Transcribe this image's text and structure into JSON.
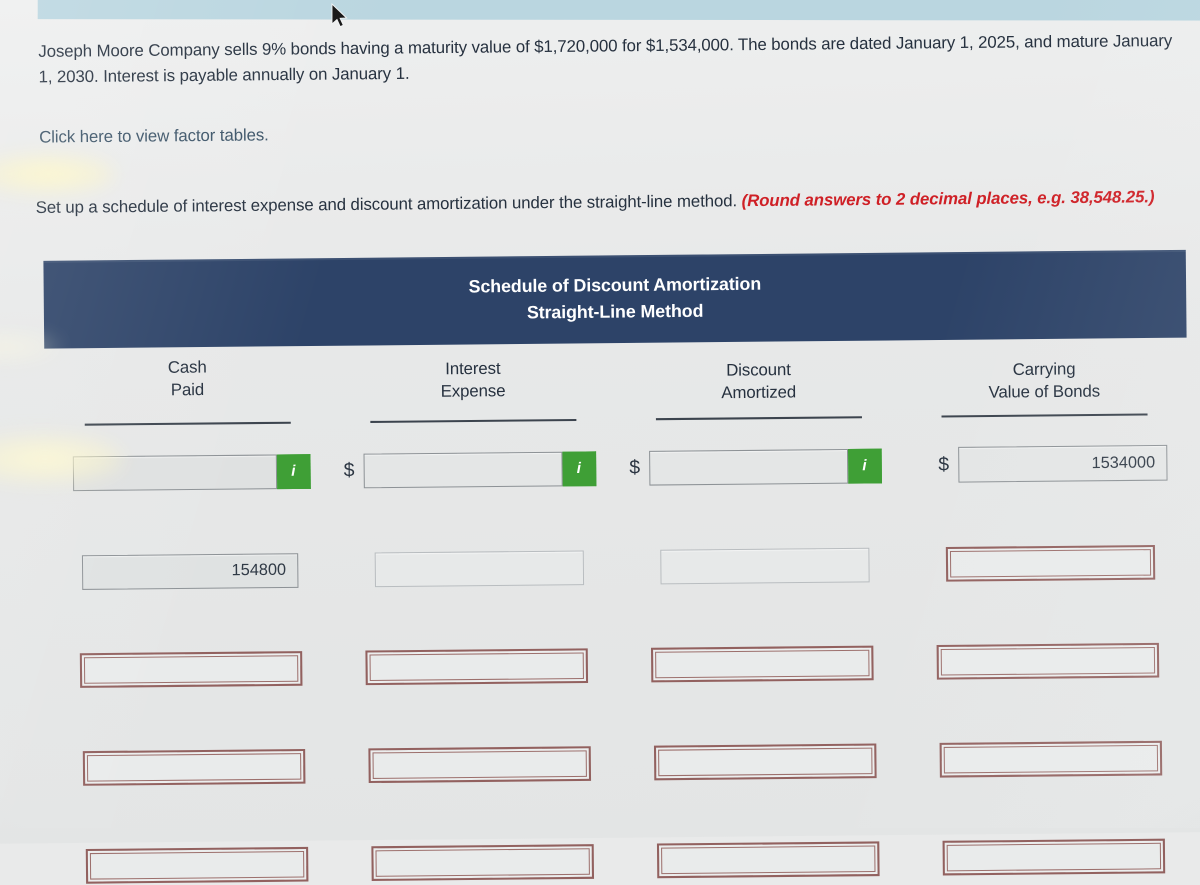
{
  "problem": {
    "text": "Joseph Moore Company sells 9% bonds having a maturity value of $1,720,000 for $1,534,000. The bonds are dated January 1, 2025, and mature January 1, 2030. Interest is payable annually on January 1."
  },
  "factor_tables_link": {
    "label": "Click here to view factor tables."
  },
  "instruction": {
    "main": "Set up a schedule of interest expense and discount amortization under the straight-line method. ",
    "emphasis": "(Round answers to 2 decimal places, e.g. 38,548.25.)"
  },
  "schedule": {
    "title_line1": "Schedule of Discount Amortization",
    "title_line2": "Straight-Line Method",
    "columns": [
      {
        "line1": "Cash",
        "line2": "Paid"
      },
      {
        "line1": "Interest",
        "line2": "Expense"
      },
      {
        "line1": "Discount",
        "line2": "Amortized"
      },
      {
        "line1": "Carrying",
        "line2": "Value of Bonds"
      }
    ],
    "rows": [
      {
        "cells": [
          {
            "dollar": "",
            "value": "",
            "info": "i",
            "state": "normal"
          },
          {
            "dollar": "$",
            "value": "",
            "info": "i",
            "state": "normal"
          },
          {
            "dollar": "$",
            "value": "",
            "info": "i",
            "state": "normal"
          },
          {
            "dollar": "$",
            "value": "1534000",
            "info": "",
            "state": "normal"
          }
        ]
      },
      {
        "cells": [
          {
            "dollar": "",
            "value": "154800",
            "info": "",
            "state": "normal"
          },
          {
            "dollar": "",
            "value": "",
            "info": "",
            "state": "plain"
          },
          {
            "dollar": "",
            "value": "",
            "info": "",
            "state": "plain"
          },
          {
            "dollar": "",
            "value": "",
            "info": "",
            "state": "error"
          }
        ]
      },
      {
        "cells": [
          {
            "dollar": "",
            "value": "",
            "info": "",
            "state": "error"
          },
          {
            "dollar": "",
            "value": "",
            "info": "",
            "state": "error"
          },
          {
            "dollar": "",
            "value": "",
            "info": "",
            "state": "error"
          },
          {
            "dollar": "",
            "value": "",
            "info": "",
            "state": "error"
          }
        ]
      },
      {
        "cells": [
          {
            "dollar": "",
            "value": "",
            "info": "",
            "state": "error"
          },
          {
            "dollar": "",
            "value": "",
            "info": "",
            "state": "error"
          },
          {
            "dollar": "",
            "value": "",
            "info": "",
            "state": "error"
          },
          {
            "dollar": "",
            "value": "",
            "info": "",
            "state": "error"
          }
        ]
      },
      {
        "cells": [
          {
            "dollar": "",
            "value": "",
            "info": "",
            "state": "error"
          },
          {
            "dollar": "",
            "value": "",
            "info": "",
            "state": "error"
          },
          {
            "dollar": "",
            "value": "",
            "info": "",
            "state": "error"
          },
          {
            "dollar": "",
            "value": "",
            "info": "",
            "state": "error"
          }
        ]
      }
    ]
  },
  "colors": {
    "header_navy": "#2d4368",
    "info_green": "#3f9f36",
    "warning_red": "#cf2026",
    "error_border": "#92615f",
    "top_strip_blue": "#bad6e0"
  }
}
